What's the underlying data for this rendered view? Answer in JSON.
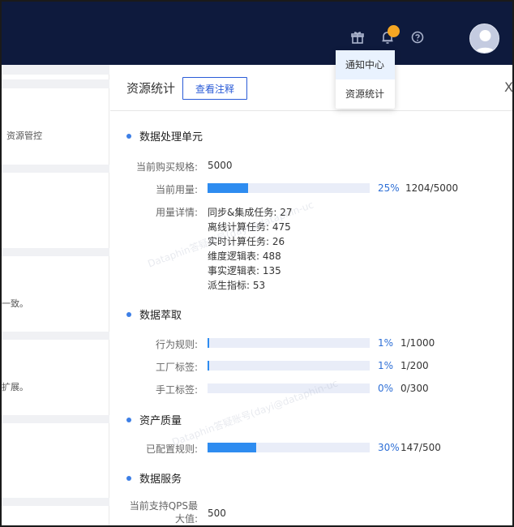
{
  "header": {
    "icons": [
      "gift-icon",
      "bell-icon",
      "help-icon"
    ],
    "accent": "#0e1a3d",
    "badge_color": "#f5a623"
  },
  "dropdown": {
    "items": [
      {
        "label": "通知中心"
      },
      {
        "label": "资源统计"
      }
    ]
  },
  "left": {
    "snippets": [
      "资源管控",
      "一致。",
      "扩展。"
    ]
  },
  "panel": {
    "title": "资源统计",
    "note_button": "查看注释",
    "close": "X",
    "sections": {
      "dpu": {
        "title": "数据处理单元",
        "purchased_label": "当前购买规格:",
        "purchased_value": "5000",
        "usage_label": "当前用量:",
        "usage_pct": "25%",
        "usage_fraction": 0.25,
        "usage_ratio": "1204/5000",
        "detail_label": "用量详情:",
        "details": [
          "同步&集成任务: 27",
          "离线计算任务: 475",
          "实时计算任务: 26",
          "维度逻辑表: 488",
          "事实逻辑表: 135",
          "派生指标: 53"
        ]
      },
      "extract": {
        "title": "数据萃取",
        "rows": [
          {
            "label": "行为规则:",
            "pct": "1%",
            "fraction": 0.01,
            "ratio": "1/1000"
          },
          {
            "label": "工厂标签:",
            "pct": "1%",
            "fraction": 0.01,
            "ratio": "1/200"
          },
          {
            "label": "手工标签:",
            "pct": "0%",
            "fraction": 0,
            "ratio": "0/300"
          }
        ]
      },
      "quality": {
        "title": "资产质量",
        "label": "已配置规则:",
        "pct": "30%",
        "fraction": 0.3,
        "ratio": "147/500"
      },
      "service": {
        "title": "数据服务",
        "label": "当前支持QPS最大值:",
        "value": "500"
      }
    }
  },
  "watermark": {
    "text": "Dataphin答疑账号(dayi@dataphin-uc"
  }
}
